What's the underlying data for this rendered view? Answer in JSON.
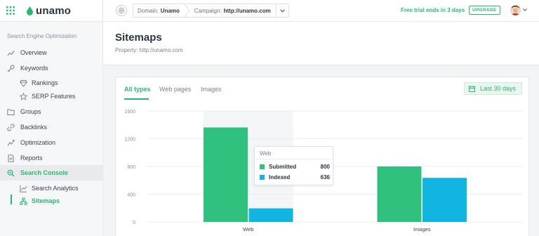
{
  "topbar": {
    "logo_text": "unamo",
    "domain_label": "Domain:",
    "domain_value": "Unamo",
    "campaign_label": "Campaign:",
    "campaign_value": "http://unamo.com",
    "trial_text": "Free trial ends in 3 days",
    "upgrade_label": "UPGRADE"
  },
  "sidebar": {
    "heading": "Search Engine Optimization",
    "items": [
      {
        "label": "Overview",
        "icon": "trend-icon"
      },
      {
        "label": "Keywords",
        "icon": "key-icon"
      },
      {
        "label": "Rankings",
        "icon": "diamond-icon"
      },
      {
        "label": "SERP Features",
        "icon": "star-icon"
      },
      {
        "label": "Groups",
        "icon": "folder-icon"
      },
      {
        "label": "Backlinks",
        "icon": "link-icon"
      },
      {
        "label": "Optimization",
        "icon": "chart-line-icon"
      },
      {
        "label": "Reports",
        "icon": "document-icon"
      },
      {
        "label": "Search Console",
        "icon": "search-icon"
      },
      {
        "label": "Search Analytics",
        "icon": "analytics-icon"
      },
      {
        "label": "Sitemaps",
        "icon": "sitemap-icon"
      }
    ]
  },
  "page": {
    "title": "Sitemaps",
    "subtitle": "Property: http://unamo.com"
  },
  "tabs": [
    "All types",
    "Web pages",
    "Images"
  ],
  "date_range": "Last 30 days",
  "chart_data": {
    "type": "bar",
    "categories": [
      "Web",
      "Images"
    ],
    "series": [
      {
        "name": "Submitted",
        "values": [
          1362,
          800
        ],
        "color": "#2ec27e"
      },
      {
        "name": "Indexed",
        "values": [
          196,
          636
        ],
        "color": "#10b5e0"
      }
    ],
    "y_ticks": [
      0,
      400,
      800,
      1200,
      1600
    ],
    "ylim": [
      0,
      1600
    ],
    "grid": true
  },
  "tooltip": {
    "title": "Web",
    "rows": [
      {
        "label": "Submitted",
        "value": "800"
      },
      {
        "label": "Indexed",
        "value": "636"
      }
    ]
  },
  "colors": {
    "accent": "#2bb673",
    "submitted": "#2ec27e",
    "indexed": "#10b5e0"
  }
}
